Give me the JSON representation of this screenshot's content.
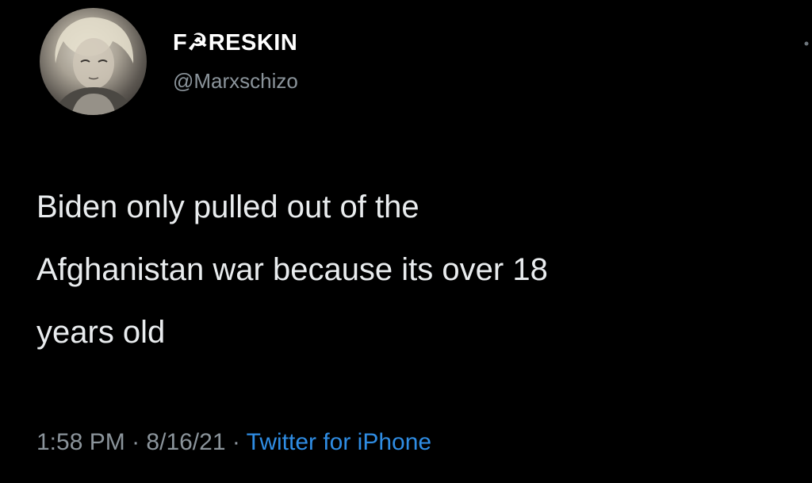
{
  "tweet": {
    "display_name": "F☭RESKIN",
    "handle": "@Marxschizo",
    "body_lines": [
      "Biden only pulled out of the",
      "Afghanistan war because its over 18",
      "years old"
    ],
    "time": "1:58 PM",
    "date": "8/16/21",
    "separator": "·",
    "source": "Twitter for iPhone"
  },
  "icons": {
    "avatar": "anime-character-avatar",
    "more": "more-options-icon"
  },
  "colors": {
    "background": "#000000",
    "text_primary": "#ffffff",
    "text_secondary": "#8b949b",
    "link": "#2f8de4"
  }
}
